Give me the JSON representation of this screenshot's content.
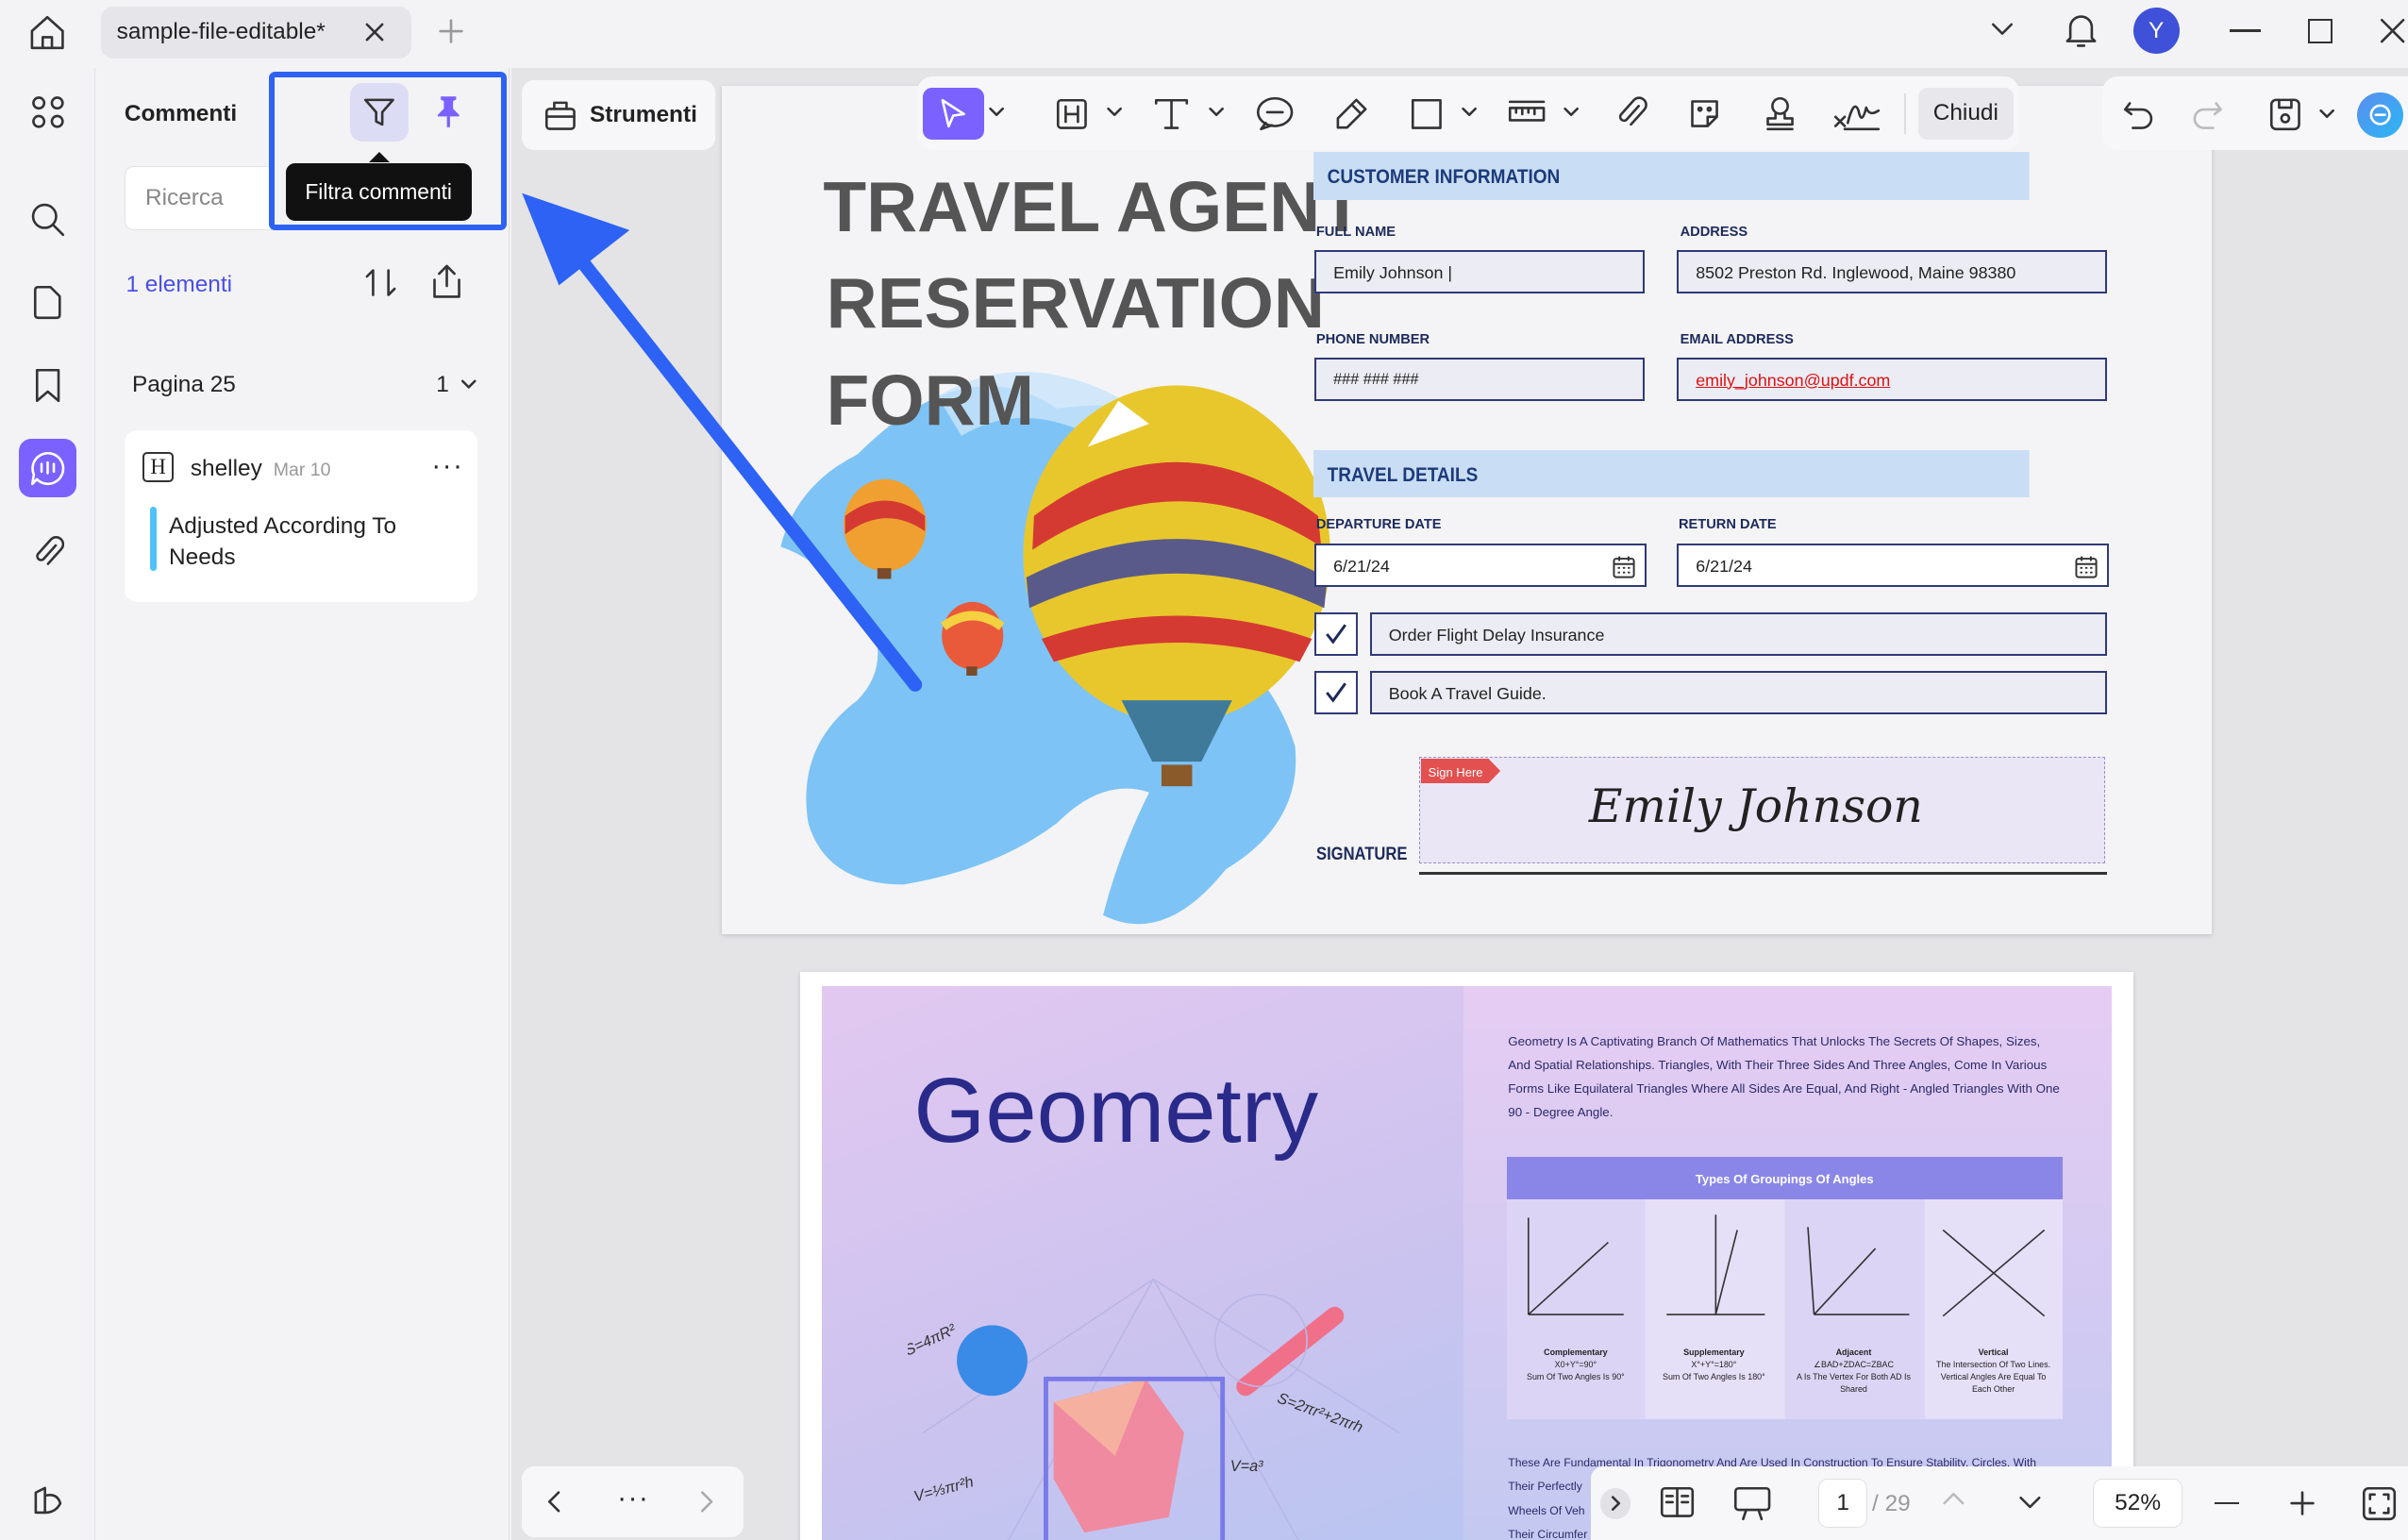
{
  "tab": {
    "title": "sample-file-editable*"
  },
  "user": {
    "initial": "Y"
  },
  "comments_panel": {
    "title": "Commenti",
    "search_placeholder": "Ricerca",
    "count": "1 elementi",
    "tooltip": "Filtra commenti",
    "group": {
      "label": "Pagina 25",
      "count": "1"
    },
    "comment": {
      "author": "shelley",
      "date": "Mar 10",
      "text": "Adjusted According To Needs"
    }
  },
  "toolbar": {
    "strumenti": "Strumenti",
    "chiudi": "Chiudi"
  },
  "form": {
    "title_lines": [
      "TRAVEL AGENT",
      "RESERVATION",
      "FORM"
    ],
    "customer_header": "CUSTOMER INFORMATION",
    "full_name_label": "FULL NAME",
    "full_name": "Emily Johnson |",
    "address_label": "ADDRESS",
    "address": "8502 Preston Rd. Inglewood, Maine 98380",
    "phone_label": "PHONE NUMBER",
    "phone": "### ### ###",
    "email_label": "EMAIL ADDRESS",
    "email": "emily_johnson@updf.com",
    "travel_header": "TRAVEL DETAILS",
    "departure_label": "DEPARTURE DATE",
    "departure": "6/21/24",
    "return_label": "RETURN DATE",
    "return": "6/21/24",
    "check1": "Order Flight Delay Insurance",
    "check2": "Book A Travel Guide.",
    "sign_here": "Sign Here",
    "signature_label": "SIGNATURE",
    "signature": "Emily Johnson"
  },
  "page2": {
    "title": "Geometry",
    "intro": "Geometry Is A Captivating Branch Of Mathematics That Unlocks The Secrets Of Shapes, Sizes, And Spatial Relationships. Triangles, With Their Three Sides And Three Angles, Come In Various Forms Like Equilateral Triangles Where All Sides Are Equal, And Right - Angled Triangles With One 90 - Degree Angle.",
    "table_title": "Types Of Groupings Of Angles",
    "angles": [
      {
        "name": "Complementary",
        "l1": "X0+Y°=90°",
        "l2": "Sum Of Two Angles Is 90°"
      },
      {
        "name": "Supplementary",
        "l1": "X°+Y°=180°",
        "l2": "Sum Of Two Angles Is 180°"
      },
      {
        "name": "Adjacent",
        "l1": "∠BAD+ZDAC=ZBAC",
        "l2": "A Is The Vertex For Both AD Is Shared"
      },
      {
        "name": "Vertical",
        "l1": "The Intersection Of Two Lines. Vertical Angles Are Equal To Each Other",
        "l2": ""
      }
    ],
    "footer_line1": "These Are Fundamental In Trigonometry And Are Used In Construction To Ensure Stability. Circles, With",
    "footer_line2": "Their Perfectly",
    "footer_line3": "Wheels Of Veh",
    "footer_line4": "Their Circumfer",
    "formulas": [
      "S=4πR²",
      "S=2πr²+2πrh",
      "V=a³",
      "V=⅓πr²h"
    ]
  },
  "zoom": {
    "page_current": "1",
    "page_total": "/ 29",
    "zoom": "52%"
  },
  "colors": {
    "accent": "#7b61ff",
    "highlight": "#2d62f5",
    "link": "#4a4fe6"
  }
}
